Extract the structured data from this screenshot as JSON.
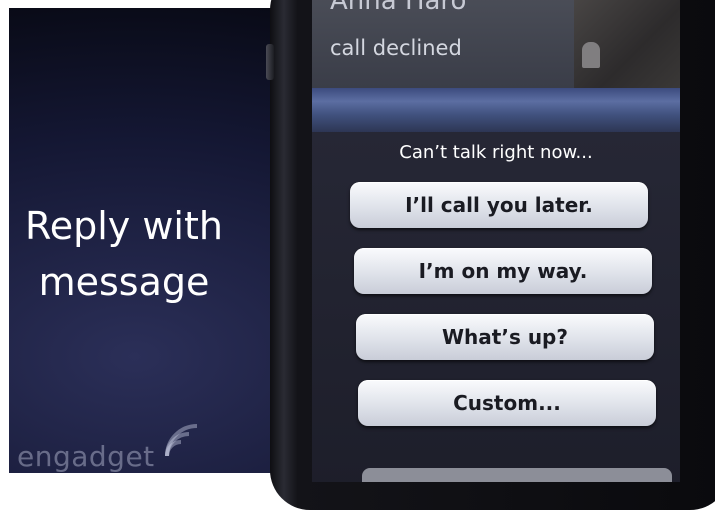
{
  "slide": {
    "title_line1": "Reply with",
    "title_line2": "message"
  },
  "watermark": "engadget",
  "phone": {
    "caller_name": "Anna Haro",
    "call_status": "call declined",
    "reply_sheet": {
      "title": "Can’t talk right now...",
      "options": [
        "I’ll call you later.",
        "I’m on my way.",
        "What’s up?",
        "Custom..."
      ]
    }
  },
  "colors": {
    "background": "#0b0d1c",
    "button": "#e3e6ee",
    "accent_band": "#4a5a8c"
  },
  "icons": {
    "watermark_mark": "wifi-arc-icon",
    "contact_photo": "person-silhouette-icon"
  }
}
